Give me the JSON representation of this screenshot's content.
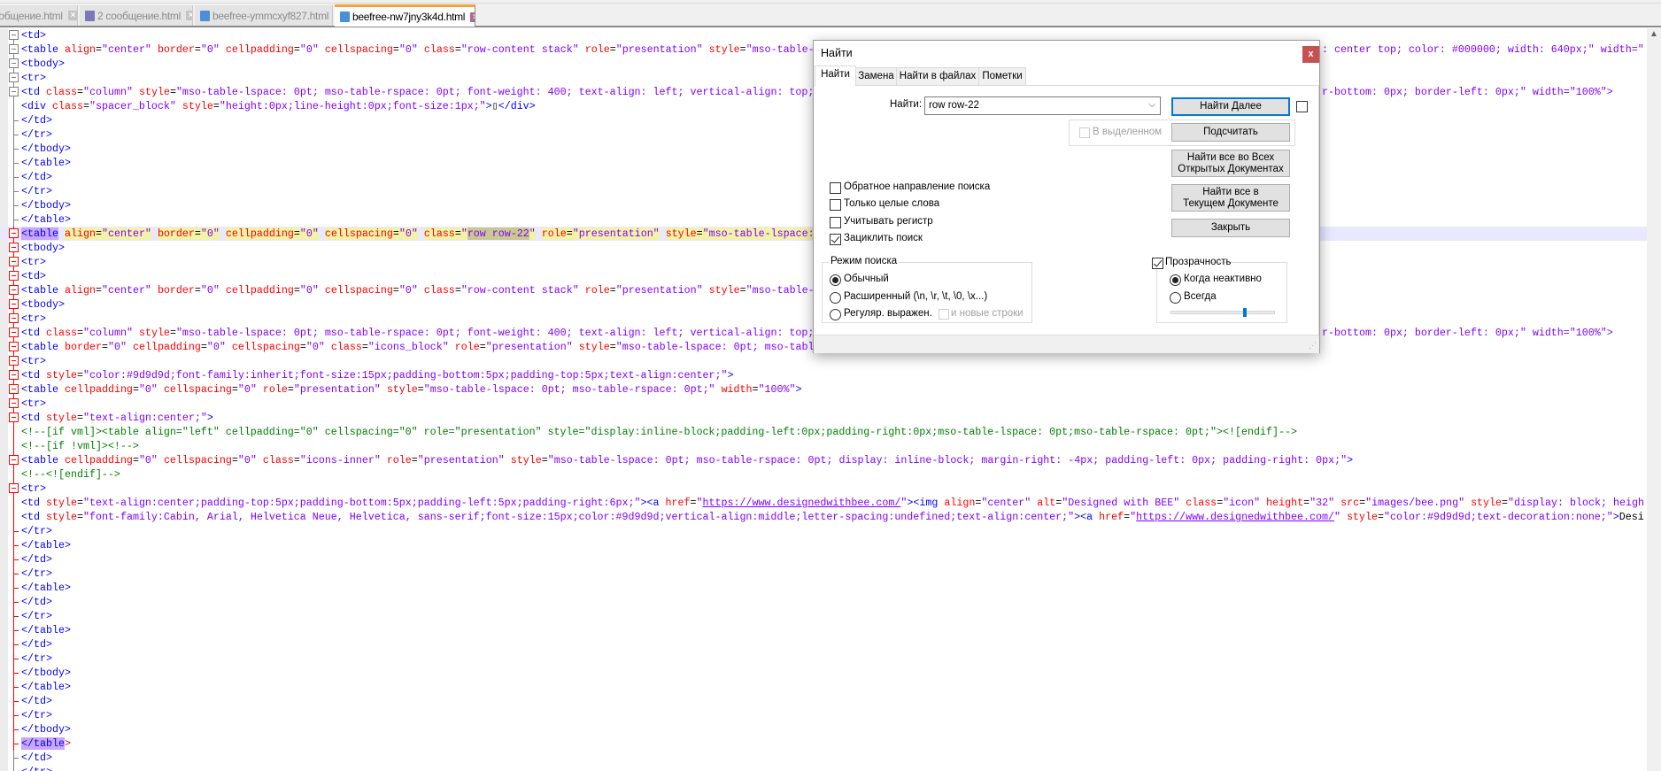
{
  "tabs": [
    {
      "label": "ообщение.html",
      "active": false,
      "icon": "save-icon",
      "icon_color": "#7b78b8"
    },
    {
      "label": "2 сообщение.html",
      "active": false,
      "icon": "save-icon",
      "icon_color": "#7b78b8"
    },
    {
      "label": "beefree-ymmcxyf827.html",
      "active": false,
      "icon": "save-icon",
      "icon_color": "#4a90d9"
    },
    {
      "label": "beefree-nw7jny3k4d.html",
      "active": true,
      "icon": "save-icon",
      "icon_color": "#4a90d9"
    }
  ],
  "colors": {
    "tag": "#0000ff",
    "attribute": "#ff0000",
    "value": "#8000ff",
    "comment": "#008000",
    "active_tab": "#f9a23a",
    "current_line": "#e8e8ff"
  },
  "editor": {
    "current_line": 15,
    "active_fold": [
      15,
      51
    ],
    "brace_match_line": 51,
    "lines": [
      {
        "text": "<td>",
        "fold": "box"
      },
      {
        "text": "<table align=\"center\" border=\"0\" cellpadding=\"0\" cellspacing=\"0\" class=\"row-content stack\" role=\"presentation\" style=\"mso-table-",
        "right": ": center top; color: #000000; width: 640px;\" width=\"",
        "fold": "box"
      },
      {
        "text": "<tbody>",
        "fold": "box"
      },
      {
        "text": "<tr>",
        "fold": "box"
      },
      {
        "text": "<td class=\"column\" style=\"mso-table-lspace: 0pt; mso-table-rspace: 0pt; font-weight: 400; text-align: left; vertical-align: top;",
        "right": "r-bottom: 0px; border-left: 0px;\" width=\"100%\">",
        "fold": "box"
      },
      {
        "text": "<div class=\"spacer_block\" style=\"height:0px;line-height:0px;font-size:1px;\">▯</div>",
        "fold": "none"
      },
      {
        "text": "</td>",
        "fold": "tick"
      },
      {
        "text": "</tr>",
        "fold": "tick"
      },
      {
        "text": "</tbody>",
        "fold": "tick"
      },
      {
        "text": "</table>",
        "fold": "tick"
      },
      {
        "text": "</td>",
        "fold": "tick"
      },
      {
        "text": "</tr>",
        "fold": "tick"
      },
      {
        "text": "</tbody>",
        "fold": "tick"
      },
      {
        "text": "</table>",
        "fold": "tick"
      },
      {
        "text": "<table align=\"center\" border=\"0\" cellpadding=\"0\" cellspacing=\"0\" class=\"row row-22\" role=\"presentation\" style=\"mso-table-lspace:",
        "fold": "box",
        "match": "row row-22"
      },
      {
        "text": "<tbody>",
        "fold": "box"
      },
      {
        "text": "<tr>",
        "fold": "box"
      },
      {
        "text": "<td>",
        "fold": "box"
      },
      {
        "text": "<table align=\"center\" border=\"0\" cellpadding=\"0\" cellspacing=\"0\" class=\"row-content stack\" role=\"presentation\" style=\"mso-table-",
        "fold": "box"
      },
      {
        "text": "<tbody>",
        "fold": "box"
      },
      {
        "text": "<tr>",
        "fold": "box"
      },
      {
        "text": "<td class=\"column\" style=\"mso-table-lspace: 0pt; mso-table-rspace: 0pt; font-weight: 400; text-align: left; vertical-align: top;",
        "right": "r-bottom: 0px; border-left: 0px;\" width=\"100%\">",
        "fold": "box"
      },
      {
        "text": "<table border=\"0\" cellpadding=\"0\" cellspacing=\"0\" class=\"icons_block\" role=\"presentation\" style=\"mso-table-lspace: 0pt; mso-tabl",
        "fold": "box"
      },
      {
        "text": "<tr>",
        "fold": "box"
      },
      {
        "text": "<td style=\"color:#9d9d9d;font-family:inherit;font-size:15px;padding-bottom:5px;padding-top:5px;text-align:center;\">",
        "fold": "box"
      },
      {
        "text": "<table cellpadding=\"0\" cellspacing=\"0\" role=\"presentation\" style=\"mso-table-lspace: 0pt; mso-table-rspace: 0pt;\" width=\"100%\">",
        "fold": "box"
      },
      {
        "text": "<tr>",
        "fold": "box"
      },
      {
        "text": "<td style=\"text-align:center;\">",
        "fold": "box"
      },
      {
        "text": "<!--[if vml]><table align=\"left\" cellpadding=\"0\" cellspacing=\"0\" role=\"presentation\" style=\"display:inline-block;padding-left:0px;padding-right:0px;mso-table-lspace: 0pt;mso-table-rspace: 0pt;\"><![endif]-->",
        "fold": "none"
      },
      {
        "text": "<!--[if !vml]><!-->",
        "fold": "none"
      },
      {
        "text": "<table cellpadding=\"0\" cellspacing=\"0\" class=\"icons-inner\" role=\"presentation\" style=\"mso-table-lspace: 0pt; mso-table-rspace: 0pt; display: inline-block; margin-right: -4px; padding-left: 0px; padding-right: 0px;\">",
        "fold": "box"
      },
      {
        "text": "<!--<![endif]-->",
        "fold": "none"
      },
      {
        "text": "<tr>",
        "fold": "box"
      },
      {
        "text": "<td style=\"text-align:center;padding-top:5px;padding-bottom:5px;padding-left:5px;padding-right:6px;\"><a href=\"https://www.designedwithbee.com/\"><img align=\"center\" alt=\"Designed with BEE\" class=\"icon\" height=\"32\" src=\"images/bee.png\" style=\"display: block; heigh",
        "fold": "none"
      },
      {
        "text": "<td style=\"font-family:Cabin, Arial, Helvetica Neue, Helvetica, sans-serif;font-size:15px;color:#9d9d9d;vertical-align:middle;letter-spacing:undefined;text-align:center;\"><a href=\"https://www.designedwithbee.com/\" style=\"color:#9d9d9d;text-decoration:none;\">Desi",
        "fold": "none"
      },
      {
        "text": "</tr>",
        "fold": "tick"
      },
      {
        "text": "</table>",
        "fold": "tick"
      },
      {
        "text": "</td>",
        "fold": "tick"
      },
      {
        "text": "</tr>",
        "fold": "tick"
      },
      {
        "text": "</table>",
        "fold": "tick"
      },
      {
        "text": "</td>",
        "fold": "tick"
      },
      {
        "text": "</tr>",
        "fold": "tick"
      },
      {
        "text": "</table>",
        "fold": "tick"
      },
      {
        "text": "</td>",
        "fold": "tick"
      },
      {
        "text": "</tr>",
        "fold": "tick"
      },
      {
        "text": "</tbody>",
        "fold": "tick"
      },
      {
        "text": "</table>",
        "fold": "tick"
      },
      {
        "text": "</td>",
        "fold": "tick"
      },
      {
        "text": "</tr>",
        "fold": "tick"
      },
      {
        "text": "</tbody>",
        "fold": "tick"
      },
      {
        "text": "</table>",
        "fold": "tick"
      },
      {
        "text": "</td>",
        "fold": "tick"
      },
      {
        "text": "</tr>",
        "fold": "tick"
      }
    ]
  },
  "dialog": {
    "title": "Найти",
    "close": "x",
    "tabs": [
      "Найти",
      "Замена",
      "Найти в файлах",
      "Пометки"
    ],
    "find_label": "Найти:",
    "find_value": "row row-22",
    "buttons": {
      "find_next": "Найти Далее",
      "count": "Подсчитать",
      "find_all_open_1": "Найти все во Всех",
      "find_all_open_2": "Открытых Документах",
      "find_all_current_1": "Найти все в",
      "find_all_current_2": "Текущем Документе",
      "close": "Закрыть"
    },
    "in_selection": {
      "label": "В выделенном",
      "checked": false,
      "disabled": true
    },
    "options": [
      {
        "label": "Обратное направление поиска",
        "checked": false
      },
      {
        "label": "Только целые слова",
        "checked": false
      },
      {
        "label": "Учитывать регистр",
        "checked": false
      },
      {
        "label": "Зациклить поиск",
        "checked": true
      }
    ],
    "search_mode": {
      "title": "Режим поиска",
      "options": [
        "Обычный",
        "Расширенный (\\n, \\r, \\t, \\0, \\x...)",
        "Регуляр. выражен."
      ],
      "selected": 0,
      "newline_label": "и новые строки"
    },
    "transparency": {
      "title": "Прозрачность",
      "checked": true,
      "options": [
        "Когда неактивно",
        "Всегда"
      ],
      "selected": 0,
      "slider_percent": 71
    }
  }
}
